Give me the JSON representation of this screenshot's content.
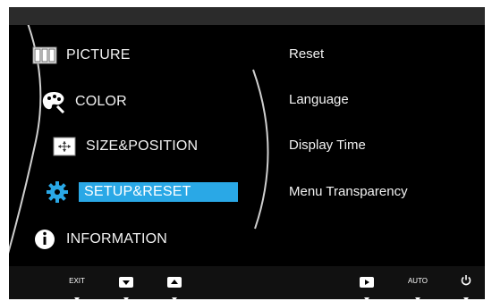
{
  "menu": {
    "items": [
      {
        "label": "PICTURE",
        "icon": "picture-icon"
      },
      {
        "label": "COLOR",
        "icon": "palette-icon"
      },
      {
        "label": "SIZE&POSITION",
        "icon": "move-icon"
      },
      {
        "label": "SETUP&RESET",
        "icon": "gear-icon",
        "selected": true
      },
      {
        "label": "INFORMATION",
        "icon": "info-icon"
      }
    ]
  },
  "submenu": {
    "items": [
      "Reset",
      "Language",
      "Display Time",
      "Menu Transparency"
    ]
  },
  "footer": {
    "exit_label": "EXIT",
    "auto_label": "AUTO"
  },
  "colors": {
    "accent": "#2aa8e6",
    "background": "#000000"
  }
}
